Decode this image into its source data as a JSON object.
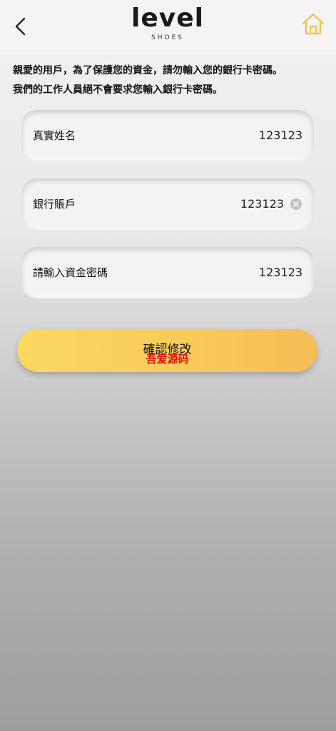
{
  "header": {
    "logo_text": "level",
    "logo_subtext": "SHOES",
    "back_icon": "chevron-left-icon",
    "home_icon": "home-icon",
    "home_icon_color": "#f5c05a"
  },
  "notice": {
    "line1": "親愛的用戶，為了保護您的資金，請勿輸入您的銀行卡密碼。",
    "line2": "我們的工作人員絕不會要求您輸入銀行卡密碼。"
  },
  "form": {
    "fields": [
      {
        "label": "真實姓名",
        "value": "123123"
      },
      {
        "label": "銀行賬戶",
        "value": "123123",
        "clear_icon": "clear-circle-icon"
      },
      {
        "label": "請輸入資金密碼",
        "value": "123123"
      }
    ]
  },
  "confirm": {
    "label": "確認修改",
    "watermark": "吾爱源码",
    "gradient_start": "#fbd85f",
    "gradient_end": "#f7bd57"
  }
}
